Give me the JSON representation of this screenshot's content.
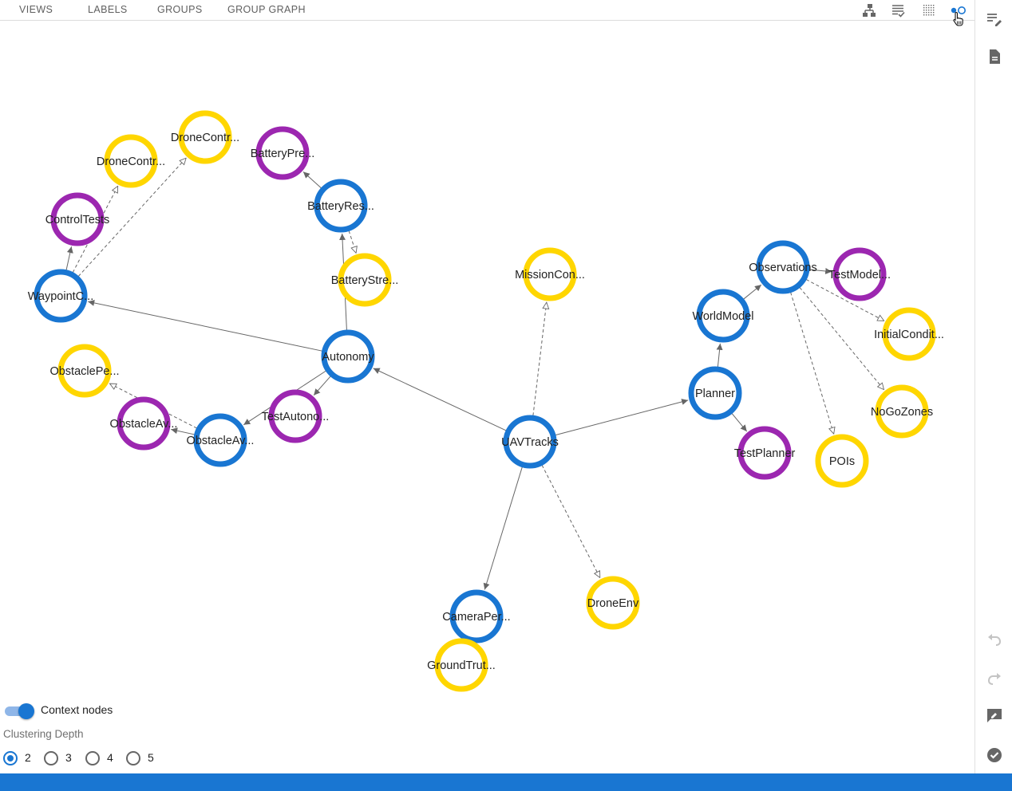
{
  "tabs": [
    {
      "label": "VIEWS"
    },
    {
      "label": "LABELS"
    },
    {
      "label": "GROUPS"
    },
    {
      "label": "GROUP GRAPH"
    }
  ],
  "toolbar": {
    "icons": [
      "hierarchy-layout-icon",
      "list-check-icon",
      "grid-dots-icon",
      "cluster-view-icon"
    ],
    "active": "cluster-view-icon"
  },
  "sidebar": {
    "top_icons": [
      "edit-list-icon",
      "document-icon"
    ],
    "bottom_icons": [
      "undo-icon",
      "redo-icon",
      "feedback-icon",
      "check-circle-icon"
    ]
  },
  "colors": {
    "accent": "#1976d2",
    "node_blue": "#1976d2",
    "node_yellow": "#ffd600",
    "node_purple": "#9c27b0",
    "edge": "#666666"
  },
  "graph": {
    "nodes": [
      {
        "id": "uavtracks",
        "label": "UAVTracks",
        "kind": "blue"
      },
      {
        "id": "autonomy",
        "label": "Autonomy",
        "kind": "blue"
      },
      {
        "id": "waypoint",
        "label": "WaypointC...",
        "kind": "blue"
      },
      {
        "id": "batteryres",
        "label": "BatteryRes...",
        "kind": "blue"
      },
      {
        "id": "batterystre",
        "label": "BatteryStre...",
        "kind": "yellow"
      },
      {
        "id": "batterypre",
        "label": "BatteryPre...",
        "kind": "purple"
      },
      {
        "id": "controltests",
        "label": "ControlTests",
        "kind": "purple"
      },
      {
        "id": "dronecontr1",
        "label": "DroneContr...",
        "kind": "yellow"
      },
      {
        "id": "dronecontr2",
        "label": "DroneContr...",
        "kind": "yellow"
      },
      {
        "id": "testautono",
        "label": "TestAutono...",
        "kind": "purple"
      },
      {
        "id": "obstacleav1",
        "label": "ObstacleAv...",
        "kind": "blue"
      },
      {
        "id": "obstacleav2",
        "label": "ObstacleAv...",
        "kind": "purple"
      },
      {
        "id": "obstaclepe",
        "label": "ObstaclePe...",
        "kind": "yellow"
      },
      {
        "id": "missioncon",
        "label": "MissionCon...",
        "kind": "yellow"
      },
      {
        "id": "planner",
        "label": "Planner",
        "kind": "blue"
      },
      {
        "id": "worldmodel",
        "label": "WorldModel",
        "kind": "blue"
      },
      {
        "id": "observations",
        "label": "Observations",
        "kind": "blue"
      },
      {
        "id": "testmodel",
        "label": "TestModel...",
        "kind": "purple"
      },
      {
        "id": "initialcondit",
        "label": "InitialCondit...",
        "kind": "yellow"
      },
      {
        "id": "nogozones",
        "label": "NoGoZones",
        "kind": "yellow"
      },
      {
        "id": "pois",
        "label": "POIs",
        "kind": "yellow"
      },
      {
        "id": "testplanner",
        "label": "TestPlanner",
        "kind": "purple"
      },
      {
        "id": "cameraper",
        "label": "CameraPer...",
        "kind": "blue"
      },
      {
        "id": "groundtrut",
        "label": "GroundTrut...",
        "kind": "yellow"
      },
      {
        "id": "droneenv",
        "label": "DroneEnv",
        "kind": "yellow"
      }
    ],
    "edges": [
      {
        "from": "uavtracks",
        "to": "autonomy",
        "dashed": false
      },
      {
        "from": "uavtracks",
        "to": "planner",
        "dashed": false
      },
      {
        "from": "uavtracks",
        "to": "cameraper",
        "dashed": false
      },
      {
        "from": "uavtracks",
        "to": "missioncon",
        "dashed": true
      },
      {
        "from": "uavtracks",
        "to": "droneenv",
        "dashed": true
      },
      {
        "from": "autonomy",
        "to": "waypoint",
        "dashed": false
      },
      {
        "from": "autonomy",
        "to": "batteryres",
        "dashed": false
      },
      {
        "from": "autonomy",
        "to": "testautono",
        "dashed": false
      },
      {
        "from": "autonomy",
        "to": "obstacleav1",
        "dashed": false
      },
      {
        "from": "batteryres",
        "to": "batterypre",
        "dashed": false
      },
      {
        "from": "batteryres",
        "to": "batterystre",
        "dashed": true
      },
      {
        "from": "waypoint",
        "to": "controltests",
        "dashed": false
      },
      {
        "from": "waypoint",
        "to": "dronecontr1",
        "dashed": true
      },
      {
        "from": "waypoint",
        "to": "dronecontr2",
        "dashed": true
      },
      {
        "from": "obstacleav1",
        "to": "obstacleav2",
        "dashed": false
      },
      {
        "from": "obstacleav1",
        "to": "obstaclepe",
        "dashed": true
      },
      {
        "from": "planner",
        "to": "worldmodel",
        "dashed": false
      },
      {
        "from": "planner",
        "to": "testplanner",
        "dashed": false
      },
      {
        "from": "worldmodel",
        "to": "observations",
        "dashed": false
      },
      {
        "from": "observations",
        "to": "testmodel",
        "dashed": false
      },
      {
        "from": "observations",
        "to": "initialcondit",
        "dashed": true
      },
      {
        "from": "observations",
        "to": "nogozones",
        "dashed": true
      },
      {
        "from": "observations",
        "to": "pois",
        "dashed": true
      }
    ]
  },
  "bottom": {
    "context_nodes_label": "Context nodes",
    "context_nodes_on": true,
    "clustering_label": "Clustering Depth",
    "depth_options": [
      "2",
      "3",
      "4",
      "5"
    ],
    "selected_depth": "2"
  }
}
